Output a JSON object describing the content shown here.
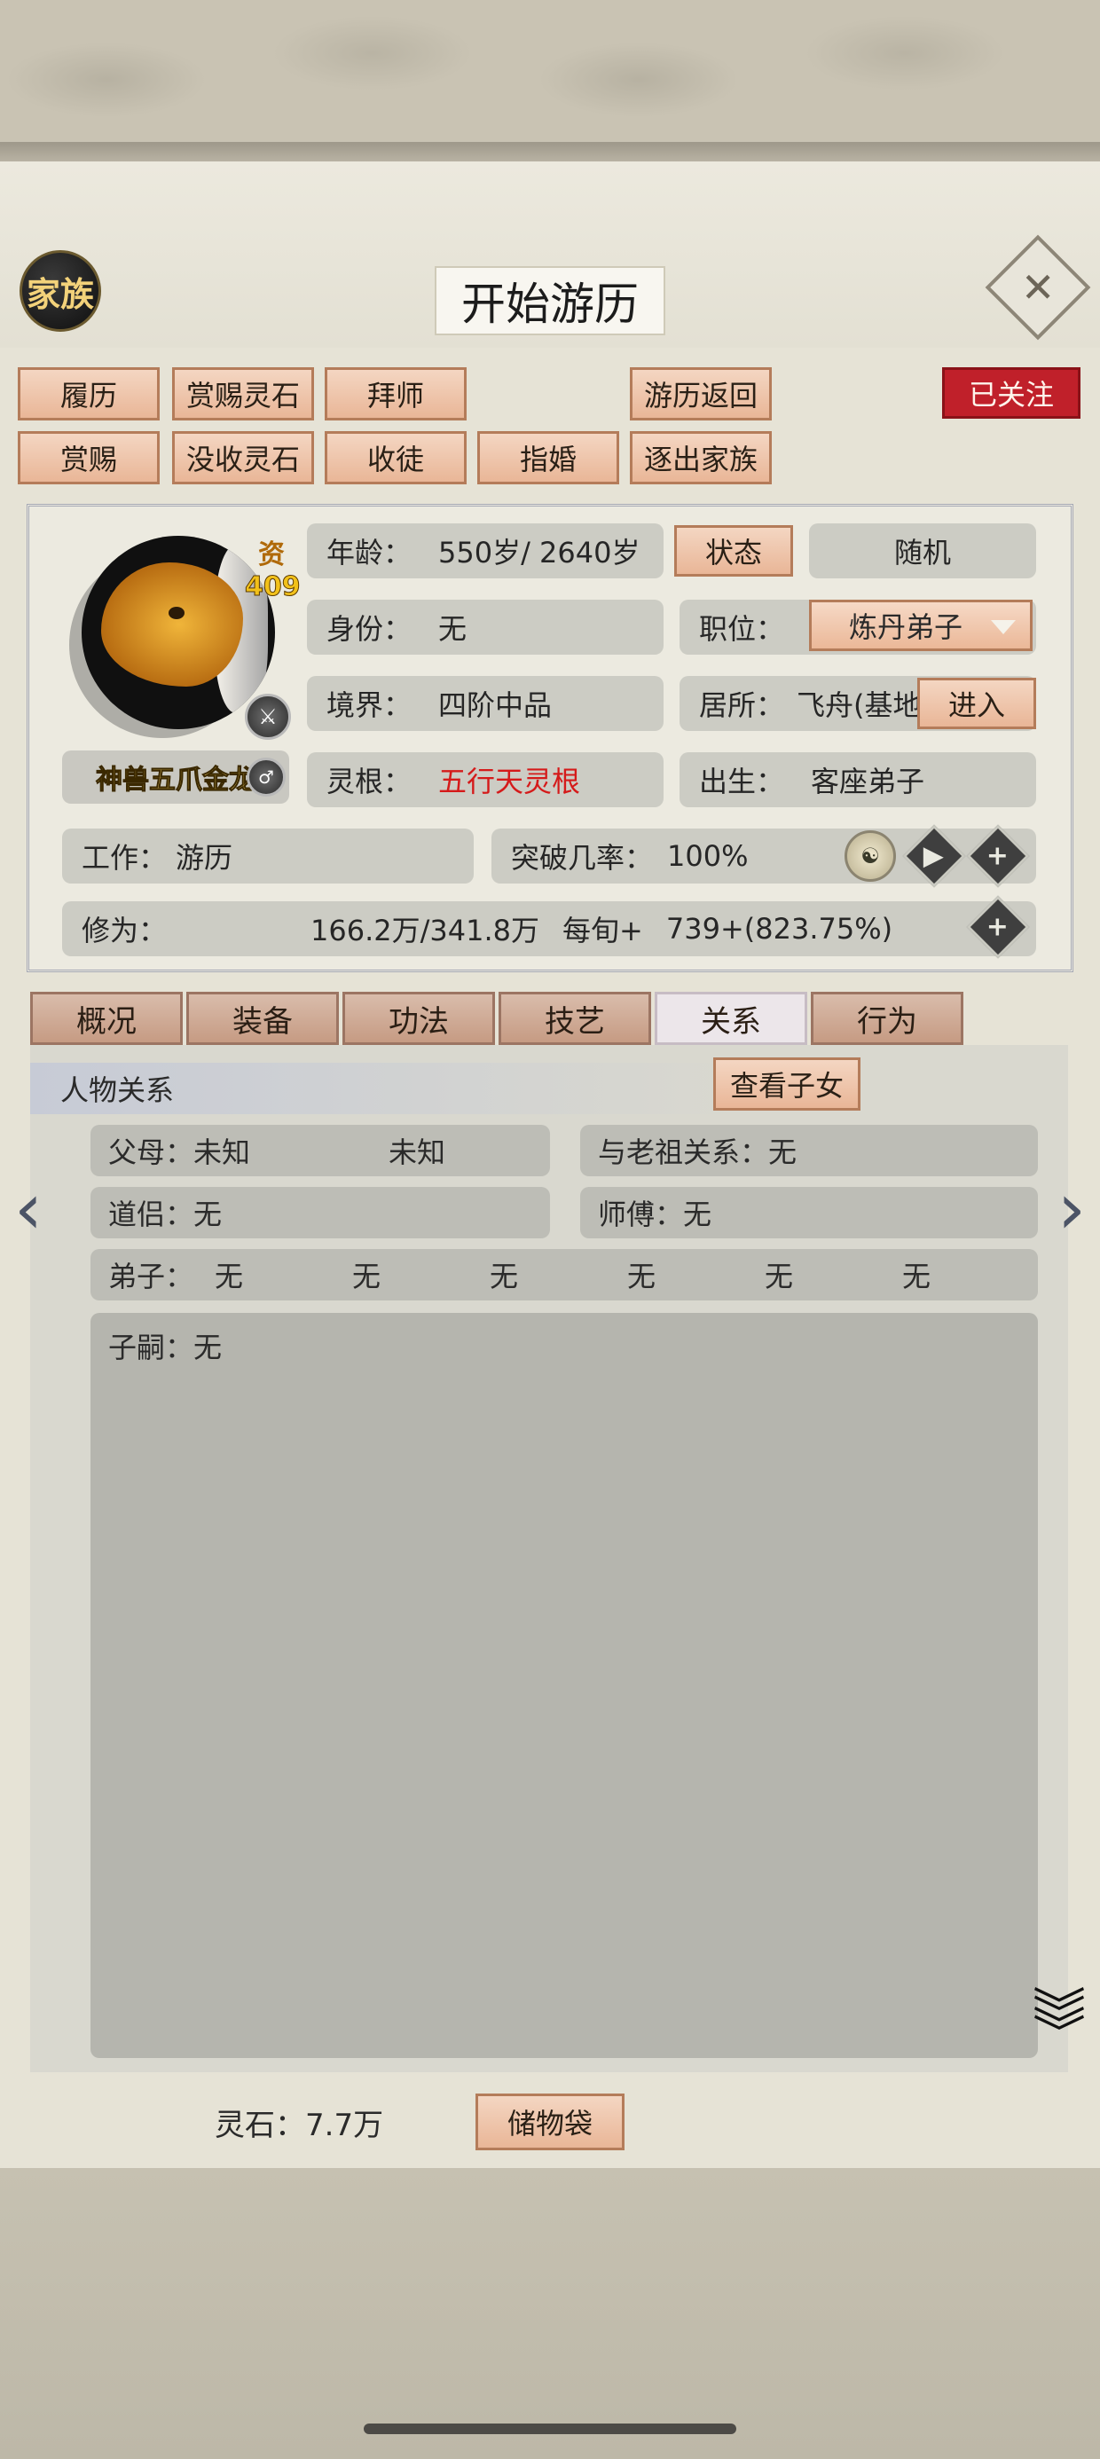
{
  "header": {
    "family_label": "家族",
    "title": "开始游历",
    "close_symbol": "✕"
  },
  "actions": {
    "row1": [
      "履历",
      "赏赐灵石",
      "拜师",
      "游历返回"
    ],
    "row2": [
      "赏赐",
      "没收灵石",
      "收徒",
      "指婚",
      "逐出家族"
    ],
    "follow": "已关注"
  },
  "character": {
    "aptitude_label": "资",
    "aptitude_value": "409",
    "title": "神兽五爪金龙",
    "age_label": "年龄：",
    "age_value": "550岁/ 2640岁",
    "status_button": "状态",
    "random_label": "随机",
    "identity_label": "身份：",
    "identity_value": "无",
    "position_label": "职位：",
    "position_value": "炼丹弟子",
    "realm_label": "境界：",
    "realm_value": "四阶中品",
    "residence_label": "居所：",
    "residence_value": "飞舟(基地",
    "enter_button": "进入",
    "root_label": "灵根：",
    "root_value": "五行天灵根",
    "birth_label": "出生：",
    "birth_value": "客座弟子",
    "work_label": "工作：",
    "work_value": "游历",
    "breakthrough_label": "突破几率：",
    "breakthrough_value": "100%",
    "cultivation_label": "修为：",
    "cultivation_value": "166.2万/341.8万",
    "per_turn_label": "每旬+",
    "per_turn_value": "739+(823.75%)"
  },
  "tabs": [
    "概况",
    "装备",
    "功法",
    "技艺",
    "关系",
    "行为"
  ],
  "active_tab": "关系",
  "relations": {
    "section_title": "人物关系",
    "view_children_button": "查看子女",
    "parents_label": "父母：",
    "parent1": "未知",
    "parent2": "未知",
    "ancestor_label": "与老祖关系：",
    "ancestor_value": "无",
    "companion_label": "道侣：",
    "companion_value": "无",
    "master_label": "师傅：",
    "master_value": "无",
    "disciples_label": "弟子：",
    "disciples": [
      "无",
      "无",
      "无",
      "无",
      "无",
      "无"
    ],
    "heirs_label": "子嗣：",
    "heirs_value": "无"
  },
  "footer": {
    "spirit_stone_label": "灵石：",
    "spirit_stone_value": "7.7万",
    "bag_button": "储物袋"
  },
  "colors": {
    "accent_button": "#e9b697",
    "follow_red": "#c0202a",
    "root_red": "#d51a1a",
    "panel_bg": "#e6e3d6"
  }
}
